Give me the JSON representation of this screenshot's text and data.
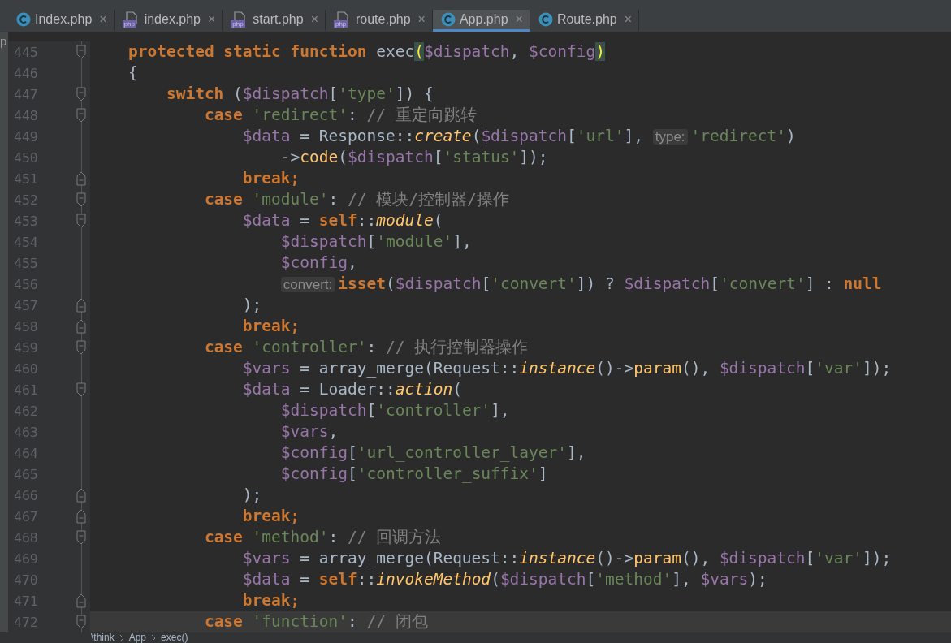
{
  "left_panel": {
    "text": "p"
  },
  "tabs": [
    {
      "label": "Index.php",
      "kind": "class",
      "close": "×",
      "selected": false
    },
    {
      "label": "index.php",
      "kind": "php",
      "badge": "php",
      "close": "×",
      "selected": false
    },
    {
      "label": "start.php",
      "kind": "php",
      "badge": "php",
      "close": "×",
      "selected": false
    },
    {
      "label": "route.php",
      "kind": "php",
      "badge": "php",
      "close": "×",
      "selected": false
    },
    {
      "label": "App.php",
      "kind": "class",
      "close": "×",
      "selected": true
    },
    {
      "label": "Route.php",
      "kind": "class",
      "close": "×",
      "selected": false
    }
  ],
  "lines": [
    {
      "number": "445",
      "kind": "fold-start",
      "current": false,
      "tokens": [
        {
          "kind": "keyword",
          "text": "    protected static function"
        },
        {
          "kind": "plain",
          "text": " exec"
        },
        {
          "kind": "brace-match",
          "text": "("
        },
        {
          "kind": "variable",
          "text": "$dispatch"
        },
        {
          "kind": "plain",
          "text": ", "
        },
        {
          "kind": "variable",
          "text": "$config"
        },
        {
          "kind": "brace-match",
          "text": ")"
        }
      ]
    },
    {
      "number": "446",
      "kind": "plain",
      "current": false,
      "tokens": [
        {
          "kind": "plain",
          "text": "    {"
        }
      ]
    },
    {
      "number": "447",
      "kind": "fold-start",
      "current": false,
      "tokens": [
        {
          "kind": "keyword",
          "text": "        switch"
        },
        {
          "kind": "plain",
          "text": " ("
        },
        {
          "kind": "variable",
          "text": "$dispatch"
        },
        {
          "kind": "plain",
          "text": "["
        },
        {
          "kind": "string",
          "text": "'type'"
        },
        {
          "kind": "plain",
          "text": "]) {"
        }
      ]
    },
    {
      "number": "448",
      "kind": "fold-start",
      "current": false,
      "tokens": [
        {
          "kind": "keyword",
          "text": "            case"
        },
        {
          "kind": "string",
          "text": " 'redirect'"
        },
        {
          "kind": "plain",
          "text": ": "
        },
        {
          "kind": "comment",
          "text": "// 重定向跳转"
        }
      ]
    },
    {
      "number": "449",
      "kind": "plain",
      "current": false,
      "tokens": [
        {
          "kind": "variable",
          "text": "                $data"
        },
        {
          "kind": "plain",
          "text": " = Response::"
        },
        {
          "kind": "method-italic",
          "text": "create"
        },
        {
          "kind": "plain",
          "text": "("
        },
        {
          "kind": "variable",
          "text": "$dispatch"
        },
        {
          "kind": "plain",
          "text": "["
        },
        {
          "kind": "string",
          "text": "'url'"
        },
        {
          "kind": "plain",
          "text": "], "
        },
        {
          "kind": "hint",
          "text": "type:"
        },
        {
          "kind": "string",
          "text": "'redirect'"
        },
        {
          "kind": "plain",
          "text": ")"
        }
      ]
    },
    {
      "number": "450",
      "kind": "plain",
      "current": false,
      "tokens": [
        {
          "kind": "plain",
          "text": "                    ->"
        },
        {
          "kind": "method",
          "text": "code"
        },
        {
          "kind": "plain",
          "text": "("
        },
        {
          "kind": "variable",
          "text": "$dispatch"
        },
        {
          "kind": "plain",
          "text": "["
        },
        {
          "kind": "string",
          "text": "'status'"
        },
        {
          "kind": "plain",
          "text": "]);"
        }
      ]
    },
    {
      "number": "451",
      "kind": "fold-end",
      "current": false,
      "tokens": [
        {
          "kind": "keyword",
          "text": "                break;"
        }
      ]
    },
    {
      "number": "452",
      "kind": "fold-start",
      "current": false,
      "tokens": [
        {
          "kind": "keyword",
          "text": "            case"
        },
        {
          "kind": "string",
          "text": " 'module'"
        },
        {
          "kind": "plain",
          "text": ": "
        },
        {
          "kind": "comment",
          "text": "// 模块/控制器/操作"
        }
      ]
    },
    {
      "number": "453",
      "kind": "fold-start",
      "current": false,
      "tokens": [
        {
          "kind": "variable",
          "text": "                $data"
        },
        {
          "kind": "plain",
          "text": " = "
        },
        {
          "kind": "keyword",
          "text": "self"
        },
        {
          "kind": "plain",
          "text": "::"
        },
        {
          "kind": "method-italic",
          "text": "module"
        },
        {
          "kind": "plain",
          "text": "("
        }
      ]
    },
    {
      "number": "454",
      "kind": "plain",
      "current": false,
      "tokens": [
        {
          "kind": "variable",
          "text": "                    $dispatch"
        },
        {
          "kind": "plain",
          "text": "["
        },
        {
          "kind": "string",
          "text": "'module'"
        },
        {
          "kind": "plain",
          "text": "],"
        }
      ]
    },
    {
      "number": "455",
      "kind": "plain",
      "current": false,
      "tokens": [
        {
          "kind": "variable",
          "text": "                    $config"
        },
        {
          "kind": "plain",
          "text": ","
        }
      ]
    },
    {
      "number": "456",
      "kind": "plain",
      "current": false,
      "tokens": [
        {
          "kind": "hint",
          "text": "                    convert:"
        },
        {
          "kind": "keyword",
          "text": "isset"
        },
        {
          "kind": "plain",
          "text": "("
        },
        {
          "kind": "variable",
          "text": "$dispatch"
        },
        {
          "kind": "plain",
          "text": "["
        },
        {
          "kind": "string",
          "text": "'convert'"
        },
        {
          "kind": "plain",
          "text": "]) ? "
        },
        {
          "kind": "variable",
          "text": "$dispatch"
        },
        {
          "kind": "plain",
          "text": "["
        },
        {
          "kind": "string",
          "text": "'convert'"
        },
        {
          "kind": "plain",
          "text": "] : "
        },
        {
          "kind": "keyword",
          "text": "null"
        }
      ]
    },
    {
      "number": "457",
      "kind": "fold-end",
      "current": false,
      "tokens": [
        {
          "kind": "plain",
          "text": "                );"
        }
      ]
    },
    {
      "number": "458",
      "kind": "fold-end",
      "current": false,
      "tokens": [
        {
          "kind": "keyword",
          "text": "                break;"
        }
      ]
    },
    {
      "number": "459",
      "kind": "fold-start",
      "current": false,
      "tokens": [
        {
          "kind": "keyword",
          "text": "            case"
        },
        {
          "kind": "string",
          "text": " 'controller'"
        },
        {
          "kind": "plain",
          "text": ": "
        },
        {
          "kind": "comment",
          "text": "// 执行控制器操作"
        }
      ]
    },
    {
      "number": "460",
      "kind": "plain",
      "current": false,
      "tokens": [
        {
          "kind": "variable",
          "text": "                $vars"
        },
        {
          "kind": "plain",
          "text": " = array_merge(Request::"
        },
        {
          "kind": "method-italic",
          "text": "instance"
        },
        {
          "kind": "plain",
          "text": "()->"
        },
        {
          "kind": "method",
          "text": "param"
        },
        {
          "kind": "plain",
          "text": "(), "
        },
        {
          "kind": "variable",
          "text": "$dispatch"
        },
        {
          "kind": "plain",
          "text": "["
        },
        {
          "kind": "string",
          "text": "'var'"
        },
        {
          "kind": "plain",
          "text": "]);"
        }
      ]
    },
    {
      "number": "461",
      "kind": "fold-start",
      "current": false,
      "tokens": [
        {
          "kind": "variable",
          "text": "                $data"
        },
        {
          "kind": "plain",
          "text": " = Loader::"
        },
        {
          "kind": "method-italic",
          "text": "action"
        },
        {
          "kind": "plain",
          "text": "("
        }
      ]
    },
    {
      "number": "462",
      "kind": "plain",
      "current": false,
      "tokens": [
        {
          "kind": "variable",
          "text": "                    $dispatch"
        },
        {
          "kind": "plain",
          "text": "["
        },
        {
          "kind": "string",
          "text": "'controller'"
        },
        {
          "kind": "plain",
          "text": "],"
        }
      ]
    },
    {
      "number": "463",
      "kind": "plain",
      "current": false,
      "tokens": [
        {
          "kind": "variable",
          "text": "                    $vars"
        },
        {
          "kind": "plain",
          "text": ","
        }
      ]
    },
    {
      "number": "464",
      "kind": "plain",
      "current": false,
      "tokens": [
        {
          "kind": "variable",
          "text": "                    $config"
        },
        {
          "kind": "plain",
          "text": "["
        },
        {
          "kind": "string",
          "text": "'url_controller_layer'"
        },
        {
          "kind": "plain",
          "text": "],"
        }
      ]
    },
    {
      "number": "465",
      "kind": "plain",
      "current": false,
      "tokens": [
        {
          "kind": "variable",
          "text": "                    $config"
        },
        {
          "kind": "plain",
          "text": "["
        },
        {
          "kind": "string",
          "text": "'controller_suffix'"
        },
        {
          "kind": "plain",
          "text": "]"
        }
      ]
    },
    {
      "number": "466",
      "kind": "fold-end",
      "current": false,
      "tokens": [
        {
          "kind": "plain",
          "text": "                );"
        }
      ]
    },
    {
      "number": "467",
      "kind": "fold-end",
      "current": false,
      "tokens": [
        {
          "kind": "keyword",
          "text": "                break;"
        }
      ]
    },
    {
      "number": "468",
      "kind": "fold-start",
      "current": false,
      "tokens": [
        {
          "kind": "keyword",
          "text": "            case"
        },
        {
          "kind": "string",
          "text": " 'method'"
        },
        {
          "kind": "plain",
          "text": ": "
        },
        {
          "kind": "comment",
          "text": "// 回调方法"
        }
      ]
    },
    {
      "number": "469",
      "kind": "plain",
      "current": false,
      "tokens": [
        {
          "kind": "variable",
          "text": "                $vars"
        },
        {
          "kind": "plain",
          "text": " = array_merge(Request::"
        },
        {
          "kind": "method-italic",
          "text": "instance"
        },
        {
          "kind": "plain",
          "text": "()->"
        },
        {
          "kind": "method",
          "text": "param"
        },
        {
          "kind": "plain",
          "text": "(), "
        },
        {
          "kind": "variable",
          "text": "$dispatch"
        },
        {
          "kind": "plain",
          "text": "["
        },
        {
          "kind": "string",
          "text": "'var'"
        },
        {
          "kind": "plain",
          "text": "]);"
        }
      ]
    },
    {
      "number": "470",
      "kind": "plain",
      "current": false,
      "tokens": [
        {
          "kind": "variable",
          "text": "                $data"
        },
        {
          "kind": "plain",
          "text": " = "
        },
        {
          "kind": "keyword",
          "text": "self"
        },
        {
          "kind": "plain",
          "text": "::"
        },
        {
          "kind": "method-italic",
          "text": "invokeMethod"
        },
        {
          "kind": "plain",
          "text": "("
        },
        {
          "kind": "variable",
          "text": "$dispatch"
        },
        {
          "kind": "plain",
          "text": "["
        },
        {
          "kind": "string",
          "text": "'method'"
        },
        {
          "kind": "plain",
          "text": "], "
        },
        {
          "kind": "variable",
          "text": "$vars"
        },
        {
          "kind": "plain",
          "text": ");"
        }
      ]
    },
    {
      "number": "471",
      "kind": "fold-end",
      "current": false,
      "tokens": [
        {
          "kind": "keyword",
          "text": "                break;"
        }
      ]
    },
    {
      "number": "472",
      "kind": "fold-start",
      "current": true,
      "tokens": [
        {
          "kind": "keyword",
          "text": "            case"
        },
        {
          "kind": "string",
          "text": " 'function'"
        },
        {
          "kind": "plain",
          "text": ": "
        },
        {
          "kind": "comment",
          "text": "// 闭包"
        }
      ]
    }
  ],
  "breadcrumbs": [
    "\\think",
    "App",
    "exec()"
  ]
}
